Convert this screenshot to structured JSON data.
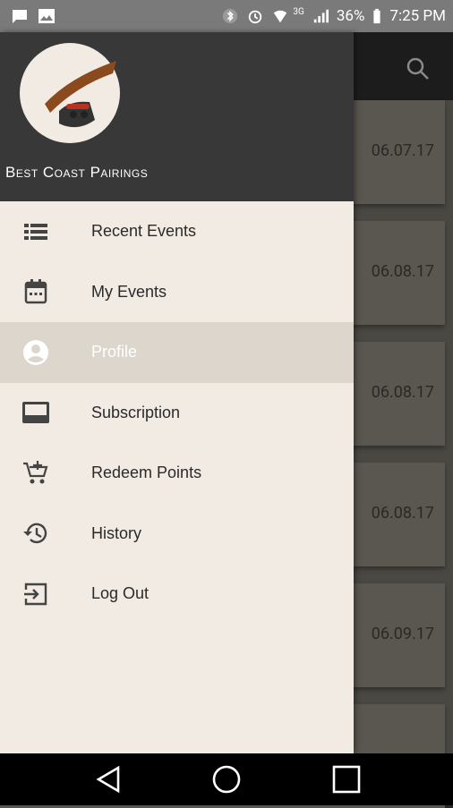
{
  "status_bar": {
    "battery": "36%",
    "time": "7:25 PM",
    "network": "3G"
  },
  "app_bar": {
    "search_icon": "search-icon"
  },
  "events": [
    {
      "date": "06.07.17"
    },
    {
      "date": "06.08.17"
    },
    {
      "date": "06.08.17"
    },
    {
      "date": "06.08.17"
    },
    {
      "date": "06.09.17"
    }
  ],
  "drawer": {
    "app_title": "Best Coast Pairings",
    "logo_text": "best coast pairings",
    "items": [
      {
        "label": "Recent Events",
        "icon": "list-icon"
      },
      {
        "label": "My Events",
        "icon": "calendar-icon"
      },
      {
        "label": "Profile",
        "icon": "account-circle-icon",
        "active": true
      },
      {
        "label": "Subscription",
        "icon": "card-icon"
      },
      {
        "label": "Redeem Points",
        "icon": "cart-add-icon"
      },
      {
        "label": "History",
        "icon": "history-icon"
      },
      {
        "label": "Log Out",
        "icon": "logout-icon"
      }
    ]
  },
  "colors": {
    "drawer_bg": "#f2ebe3",
    "header_bg": "#383838",
    "active_bg": "#dcd6cd"
  }
}
